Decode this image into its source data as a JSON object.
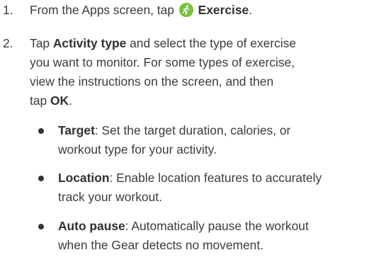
{
  "steps": [
    {
      "number": "1.",
      "lines": [
        {
          "pre": "From the Apps screen, tap ",
          "bold": "Exercise",
          "post": "."
        }
      ],
      "icon": "running-figure-icon"
    },
    {
      "number": "2.",
      "lines": [
        {
          "pre": "Tap ",
          "bold": "Activity type",
          "post": " and select the type of exercise"
        },
        {
          "text": "you want to monitor. For some types of exercise,"
        },
        {
          "text": "view the instructions on the screen, and then"
        },
        {
          "pre": "tap ",
          "bold": "OK",
          "post": "."
        }
      ]
    }
  ],
  "bullets": [
    {
      "term": "Target",
      "line1": ": Set the target duration, calories, or",
      "line2": "workout type for your activity."
    },
    {
      "term": "Location",
      "line1": ": Enable location features to accurately",
      "line2": "track your workout."
    },
    {
      "term": "Auto pause",
      "line1": ": Automatically pause the workout",
      "line2": "when the Gear detects no movement."
    }
  ],
  "colors": {
    "text": "#3c3c3c",
    "icon_green": "#78c13a"
  }
}
